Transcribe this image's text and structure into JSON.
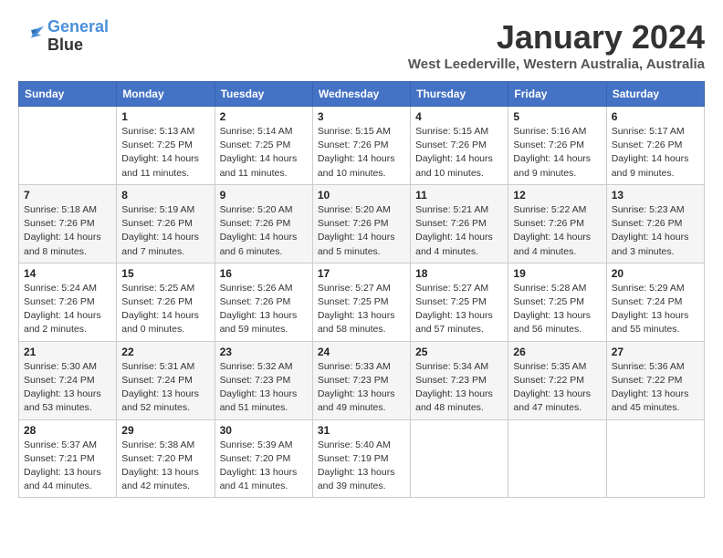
{
  "logo": {
    "line1": "General",
    "line2": "Blue"
  },
  "title": "January 2024",
  "subtitle": "West Leederville, Western Australia, Australia",
  "days_header": [
    "Sunday",
    "Monday",
    "Tuesday",
    "Wednesday",
    "Thursday",
    "Friday",
    "Saturday"
  ],
  "weeks": [
    [
      {
        "day": "",
        "info": ""
      },
      {
        "day": "1",
        "info": "Sunrise: 5:13 AM\nSunset: 7:25 PM\nDaylight: 14 hours\nand 11 minutes."
      },
      {
        "day": "2",
        "info": "Sunrise: 5:14 AM\nSunset: 7:25 PM\nDaylight: 14 hours\nand 11 minutes."
      },
      {
        "day": "3",
        "info": "Sunrise: 5:15 AM\nSunset: 7:26 PM\nDaylight: 14 hours\nand 10 minutes."
      },
      {
        "day": "4",
        "info": "Sunrise: 5:15 AM\nSunset: 7:26 PM\nDaylight: 14 hours\nand 10 minutes."
      },
      {
        "day": "5",
        "info": "Sunrise: 5:16 AM\nSunset: 7:26 PM\nDaylight: 14 hours\nand 9 minutes."
      },
      {
        "day": "6",
        "info": "Sunrise: 5:17 AM\nSunset: 7:26 PM\nDaylight: 14 hours\nand 9 minutes."
      }
    ],
    [
      {
        "day": "7",
        "info": "Sunrise: 5:18 AM\nSunset: 7:26 PM\nDaylight: 14 hours\nand 8 minutes."
      },
      {
        "day": "8",
        "info": "Sunrise: 5:19 AM\nSunset: 7:26 PM\nDaylight: 14 hours\nand 7 minutes."
      },
      {
        "day": "9",
        "info": "Sunrise: 5:20 AM\nSunset: 7:26 PM\nDaylight: 14 hours\nand 6 minutes."
      },
      {
        "day": "10",
        "info": "Sunrise: 5:20 AM\nSunset: 7:26 PM\nDaylight: 14 hours\nand 5 minutes."
      },
      {
        "day": "11",
        "info": "Sunrise: 5:21 AM\nSunset: 7:26 PM\nDaylight: 14 hours\nand 4 minutes."
      },
      {
        "day": "12",
        "info": "Sunrise: 5:22 AM\nSunset: 7:26 PM\nDaylight: 14 hours\nand 4 minutes."
      },
      {
        "day": "13",
        "info": "Sunrise: 5:23 AM\nSunset: 7:26 PM\nDaylight: 14 hours\nand 3 minutes."
      }
    ],
    [
      {
        "day": "14",
        "info": "Sunrise: 5:24 AM\nSunset: 7:26 PM\nDaylight: 14 hours\nand 2 minutes."
      },
      {
        "day": "15",
        "info": "Sunrise: 5:25 AM\nSunset: 7:26 PM\nDaylight: 14 hours\nand 0 minutes."
      },
      {
        "day": "16",
        "info": "Sunrise: 5:26 AM\nSunset: 7:26 PM\nDaylight: 13 hours\nand 59 minutes."
      },
      {
        "day": "17",
        "info": "Sunrise: 5:27 AM\nSunset: 7:25 PM\nDaylight: 13 hours\nand 58 minutes."
      },
      {
        "day": "18",
        "info": "Sunrise: 5:27 AM\nSunset: 7:25 PM\nDaylight: 13 hours\nand 57 minutes."
      },
      {
        "day": "19",
        "info": "Sunrise: 5:28 AM\nSunset: 7:25 PM\nDaylight: 13 hours\nand 56 minutes."
      },
      {
        "day": "20",
        "info": "Sunrise: 5:29 AM\nSunset: 7:24 PM\nDaylight: 13 hours\nand 55 minutes."
      }
    ],
    [
      {
        "day": "21",
        "info": "Sunrise: 5:30 AM\nSunset: 7:24 PM\nDaylight: 13 hours\nand 53 minutes."
      },
      {
        "day": "22",
        "info": "Sunrise: 5:31 AM\nSunset: 7:24 PM\nDaylight: 13 hours\nand 52 minutes."
      },
      {
        "day": "23",
        "info": "Sunrise: 5:32 AM\nSunset: 7:23 PM\nDaylight: 13 hours\nand 51 minutes."
      },
      {
        "day": "24",
        "info": "Sunrise: 5:33 AM\nSunset: 7:23 PM\nDaylight: 13 hours\nand 49 minutes."
      },
      {
        "day": "25",
        "info": "Sunrise: 5:34 AM\nSunset: 7:23 PM\nDaylight: 13 hours\nand 48 minutes."
      },
      {
        "day": "26",
        "info": "Sunrise: 5:35 AM\nSunset: 7:22 PM\nDaylight: 13 hours\nand 47 minutes."
      },
      {
        "day": "27",
        "info": "Sunrise: 5:36 AM\nSunset: 7:22 PM\nDaylight: 13 hours\nand 45 minutes."
      }
    ],
    [
      {
        "day": "28",
        "info": "Sunrise: 5:37 AM\nSunset: 7:21 PM\nDaylight: 13 hours\nand 44 minutes."
      },
      {
        "day": "29",
        "info": "Sunrise: 5:38 AM\nSunset: 7:20 PM\nDaylight: 13 hours\nand 42 minutes."
      },
      {
        "day": "30",
        "info": "Sunrise: 5:39 AM\nSunset: 7:20 PM\nDaylight: 13 hours\nand 41 minutes."
      },
      {
        "day": "31",
        "info": "Sunrise: 5:40 AM\nSunset: 7:19 PM\nDaylight: 13 hours\nand 39 minutes."
      },
      {
        "day": "",
        "info": ""
      },
      {
        "day": "",
        "info": ""
      },
      {
        "day": "",
        "info": ""
      }
    ]
  ]
}
